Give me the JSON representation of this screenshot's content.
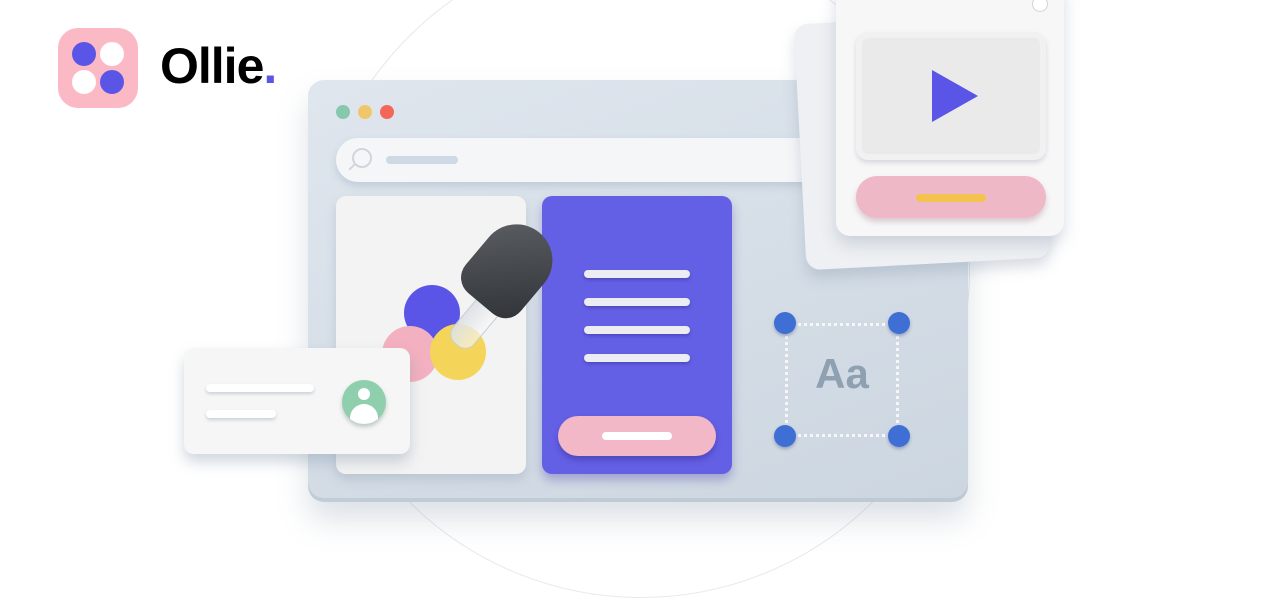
{
  "brand": {
    "name": "Ollie",
    "name_suffix": ".",
    "logo_icon": "four-dots-logo-icon",
    "colors": {
      "logo_bg": "#fbb9c6",
      "accent": "#5a55e6"
    }
  },
  "illustration": {
    "window_controls": [
      "#86c8ae",
      "#f0c66a",
      "#f2675a"
    ],
    "typography_sample": "Aa",
    "palette": [
      "#5a55e6",
      "#f3b0c0",
      "#f4d55a"
    ],
    "video_card": {
      "icon": "play-icon"
    },
    "profile_card": {
      "icon": "user-avatar-icon"
    }
  }
}
